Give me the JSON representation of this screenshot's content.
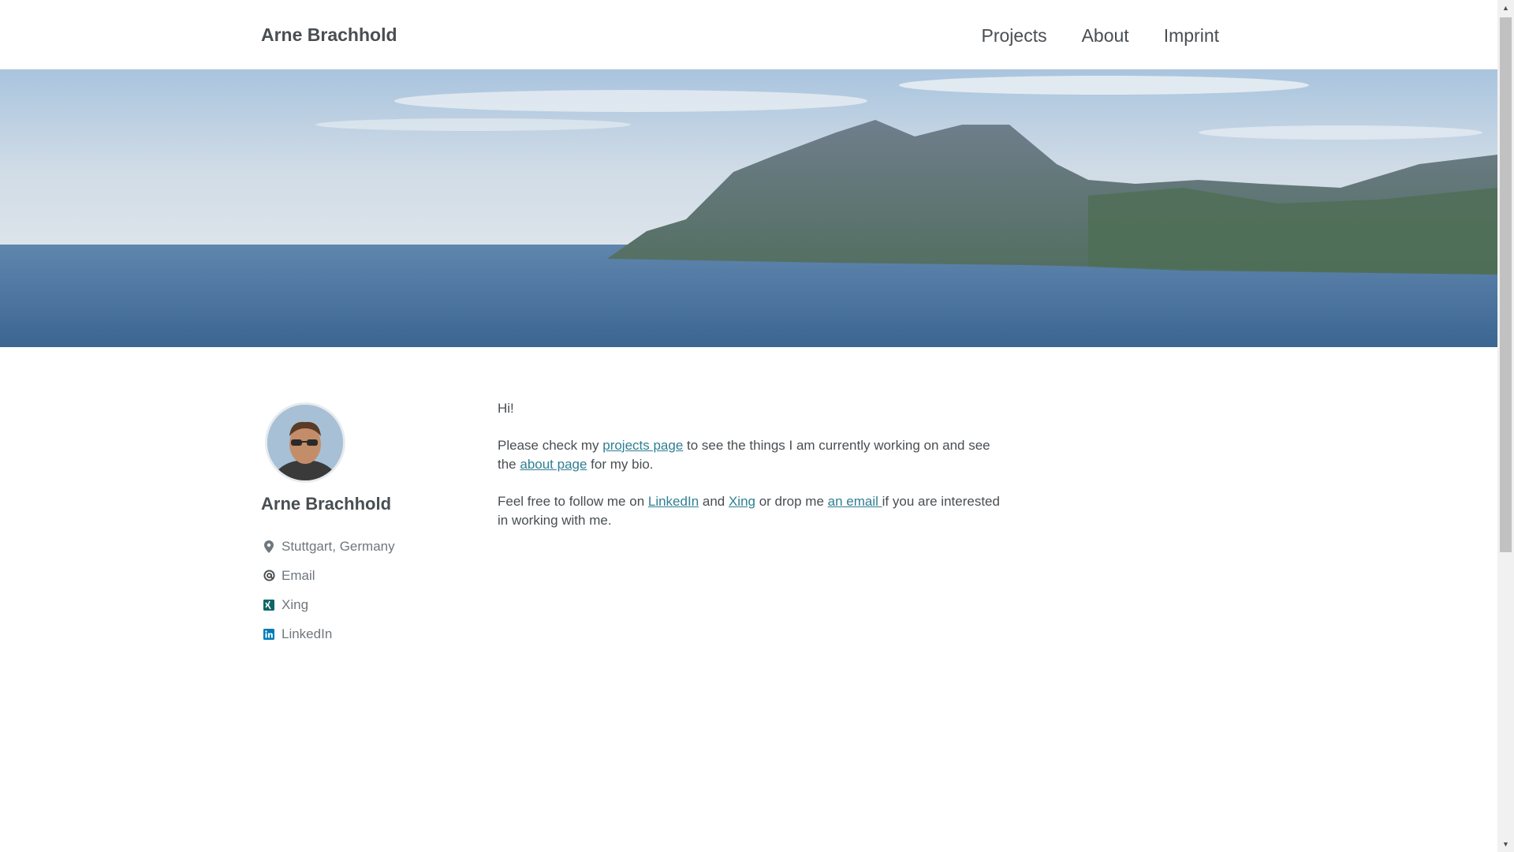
{
  "header": {
    "site_title": "Arne Brachhold",
    "nav": [
      {
        "label": "Projects"
      },
      {
        "label": "About"
      },
      {
        "label": "Imprint"
      }
    ]
  },
  "sidebar": {
    "author_name": "Arne Brachhold",
    "links": [
      {
        "icon": "map-marker-icon",
        "label": "Stuttgart, Germany"
      },
      {
        "icon": "at-sign-icon",
        "label": "Email"
      },
      {
        "icon": "xing-icon",
        "label": "Xing"
      },
      {
        "icon": "linkedin-icon",
        "label": "LinkedIn"
      }
    ]
  },
  "content": {
    "greeting": "Hi!",
    "p2": {
      "before": "Please check my ",
      "link1": "projects page",
      "middle": " to see the things I am currently working on and see the ",
      "link2": "about page",
      "after": " for my bio."
    },
    "p3": {
      "before": "Feel free to follow me on ",
      "link1": "LinkedIn",
      "mid1": " and ",
      "link2": "Xing",
      "mid2": " or drop me ",
      "link3": "an email ",
      "after": "if you are interested in working with me."
    }
  },
  "colors": {
    "link": "#2f7f93",
    "text": "#494e52",
    "muted": "#6f777d",
    "xing": "#126567",
    "linkedin": "#007bb6"
  }
}
